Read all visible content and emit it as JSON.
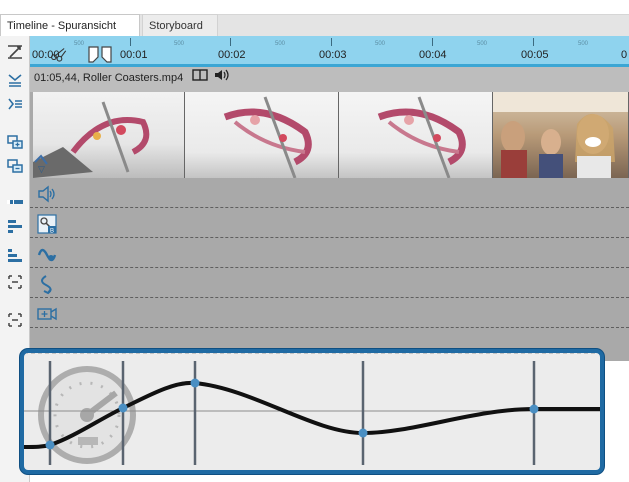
{
  "tabs": [
    {
      "label": "Timeline - Spuransicht",
      "active": true
    },
    {
      "label": "Storyboard",
      "active": false
    }
  ],
  "ruler": {
    "labels": [
      "00:00",
      "00:01",
      "00:02",
      "00:03",
      "00:04",
      "00:05",
      "0"
    ],
    "minor_label": "500"
  },
  "clip": {
    "duration": "01:05,44",
    "filename": "Roller Coasters.mp4",
    "header_text": "01:05,44, Roller Coasters.mp4"
  },
  "lanes": [
    {
      "icon": "speaker-icon"
    },
    {
      "icon": "image-blend-icon"
    },
    {
      "icon": "wave-icon"
    },
    {
      "icon": "curve-arrow-icon"
    },
    {
      "icon": "camera-add-icon"
    }
  ],
  "sidebar_tools": [
    "fit-icon",
    "align-icon",
    "list-icon",
    "add-track-icon",
    "remove-track-icon",
    "marker-icon",
    "bars-icon",
    "steps-icon",
    "expand-icon",
    "collapse-icon"
  ],
  "speed_panel": {
    "icon": "speedometer-icon",
    "keyframes": 5
  },
  "colors": {
    "ruler": "#8fd3ee",
    "ruler_border": "#3ba6d4",
    "panel_border": "#1f6aa3",
    "keyframe": "#4a8fc3"
  }
}
